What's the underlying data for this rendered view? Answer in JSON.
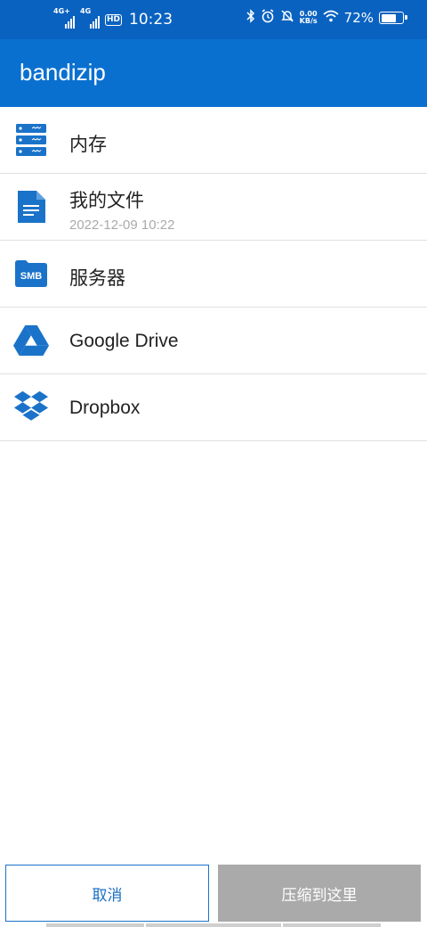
{
  "status_bar": {
    "signal1_tag": "4G+",
    "signal2_tag": "4G",
    "hd_badge": "HD",
    "time": "10:23",
    "net_rate_value": "0.00",
    "net_rate_unit": "KB/s",
    "battery_percent": "72%",
    "battery_level": 0.72,
    "icons": [
      "bluetooth-icon",
      "alarm-icon",
      "mute-icon",
      "wifi-icon",
      "battery-icon"
    ]
  },
  "app_bar": {
    "title": "bandizip"
  },
  "locations": [
    {
      "label": "内存",
      "subtitle": "",
      "icon": "server-storage-icon"
    },
    {
      "label": "我的文件",
      "subtitle": "2022-12-09 10:22",
      "icon": "document-icon"
    },
    {
      "label": "服务器",
      "subtitle": "",
      "icon": "smb-folder-icon",
      "icon_text": "SMB"
    },
    {
      "label": "Google Drive",
      "subtitle": "",
      "icon": "google-drive-icon"
    },
    {
      "label": "Dropbox",
      "subtitle": "",
      "icon": "dropbox-icon"
    }
  ],
  "buttons": {
    "cancel": "取消",
    "compress_here": "压缩到这里"
  },
  "colors": {
    "status_bar": "#0a62c0",
    "app_bar": "#0a70d0",
    "icon_blue": "#1a73c9",
    "disabled_button": "#aaaaaa"
  }
}
